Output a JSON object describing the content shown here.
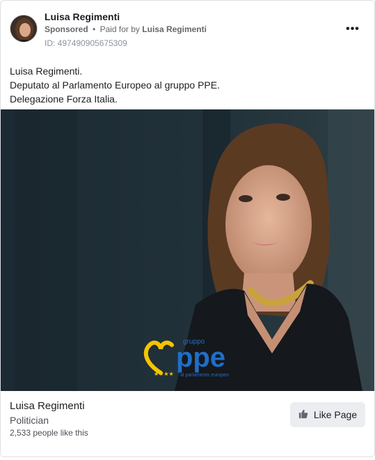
{
  "post": {
    "page_name": "Luisa Regimenti",
    "sponsored": "Sponsored",
    "separator": "•",
    "paid_for_prefix": "Paid for by",
    "paid_for_by": "Luisa Regimenti",
    "ad_id": "ID: 497490905675309",
    "more_icon": "more-horizontal-icon",
    "body_lines": [
      "Luisa Regimenti.",
      "Deputato al Parlamento Europeo al gruppo PPE.",
      "Delegazione Forza Italia."
    ]
  },
  "image": {
    "logo_small_text": "gruppo",
    "logo_main_text": "ppe",
    "logo_sub_text": "al parlamento europeo",
    "logo_color_blue": "#1e6fc9",
    "logo_color_yellow": "#f4c400"
  },
  "footer": {
    "page_name": "Luisa Regimenti",
    "category": "Politician",
    "likes": "2,533 people like this",
    "like_button_label": "Like Page",
    "like_icon": "thumbs-up-icon"
  }
}
